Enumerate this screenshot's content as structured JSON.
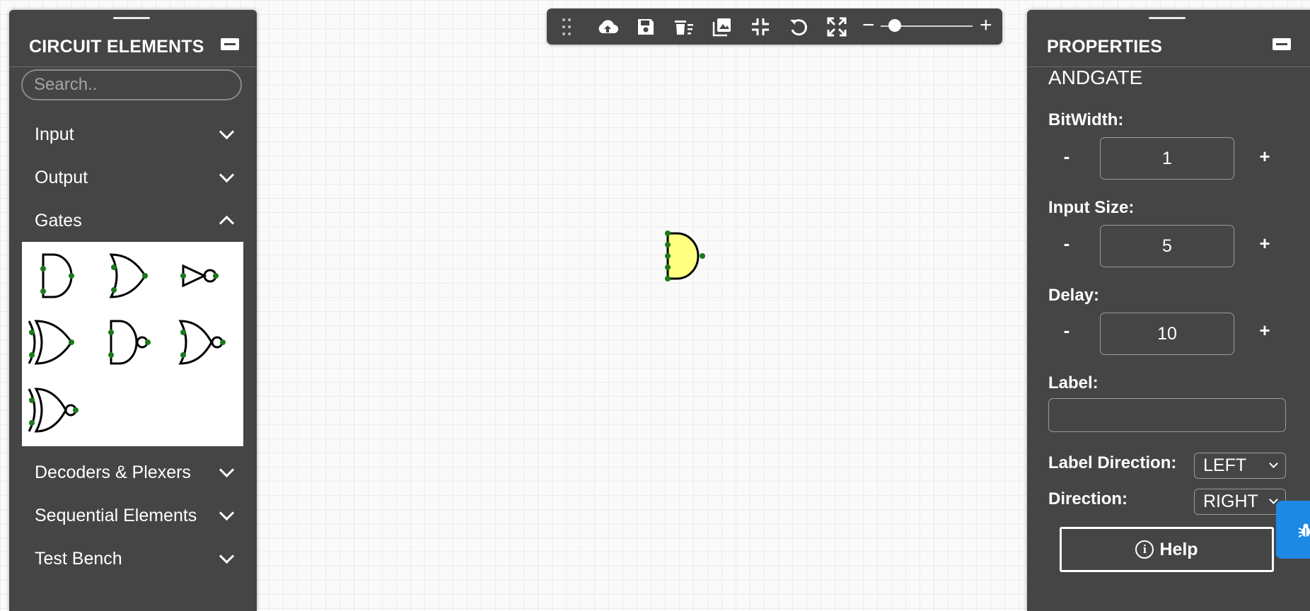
{
  "left_panel": {
    "title": "CIRCUIT ELEMENTS",
    "search_placeholder": "Search..",
    "categories": [
      {
        "label": "Input",
        "expanded": false
      },
      {
        "label": "Output",
        "expanded": false
      },
      {
        "label": "Gates",
        "expanded": true
      },
      {
        "label": "Decoders & Plexers",
        "expanded": false
      },
      {
        "label": "Sequential Elements",
        "expanded": false
      },
      {
        "label": "Test Bench",
        "expanded": false
      }
    ],
    "gate_icons": [
      "and-gate-icon",
      "or-gate-icon",
      "not-gate-icon",
      "xor-gate-icon",
      "nand-gate-icon",
      "nor-gate-icon",
      "xnor-gate-icon"
    ]
  },
  "toolbar": {
    "icons": [
      "drag-handle-icon",
      "cloud-upload-icon",
      "save-icon",
      "delete-all-icon",
      "image-icon",
      "fit-icon",
      "undo-icon",
      "fullscreen-icon"
    ],
    "zoom_minus": "−",
    "zoom_plus": "+",
    "zoom_fraction": 0.2
  },
  "canvas": {
    "element": "and-gate",
    "fill_color": "#ffff80"
  },
  "properties": {
    "title": "PROPERTIES",
    "element_name": "ANDGATE",
    "bitwidth": {
      "label": "BitWidth:",
      "value": "1"
    },
    "input_size": {
      "label": "Input Size:",
      "value": "5"
    },
    "delay": {
      "label": "Delay:",
      "value": "10"
    },
    "minus": "-",
    "plus": "+",
    "label": {
      "label": "Label:",
      "value": ""
    },
    "label_direction": {
      "label": "Label Direction:",
      "value": "LEFT"
    },
    "direction": {
      "label": "Direction:",
      "value": "RIGHT"
    },
    "help_label": "Help"
  },
  "colors": {
    "panel_bg": "#454545",
    "port_dot": "#1a7a1a",
    "report_tab": "#1e88e5"
  }
}
